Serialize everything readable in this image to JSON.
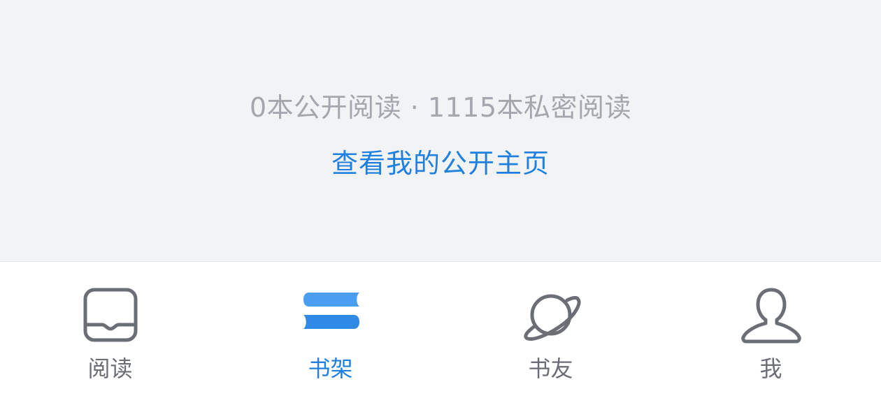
{
  "summary": {
    "stats": "0本公开阅读 · 1115本私密阅读",
    "profile_link": "查看我的公开主页"
  },
  "tabbar": {
    "active_color": "#1f80e0",
    "inactive_color": "#6b6e74",
    "items": [
      {
        "label": "阅读",
        "icon": "book-icon",
        "active": false
      },
      {
        "label": "书架",
        "icon": "bookshelf-icon",
        "active": true
      },
      {
        "label": "书友",
        "icon": "planet-icon",
        "active": false
      },
      {
        "label": "我",
        "icon": "person-icon",
        "active": false
      }
    ]
  }
}
